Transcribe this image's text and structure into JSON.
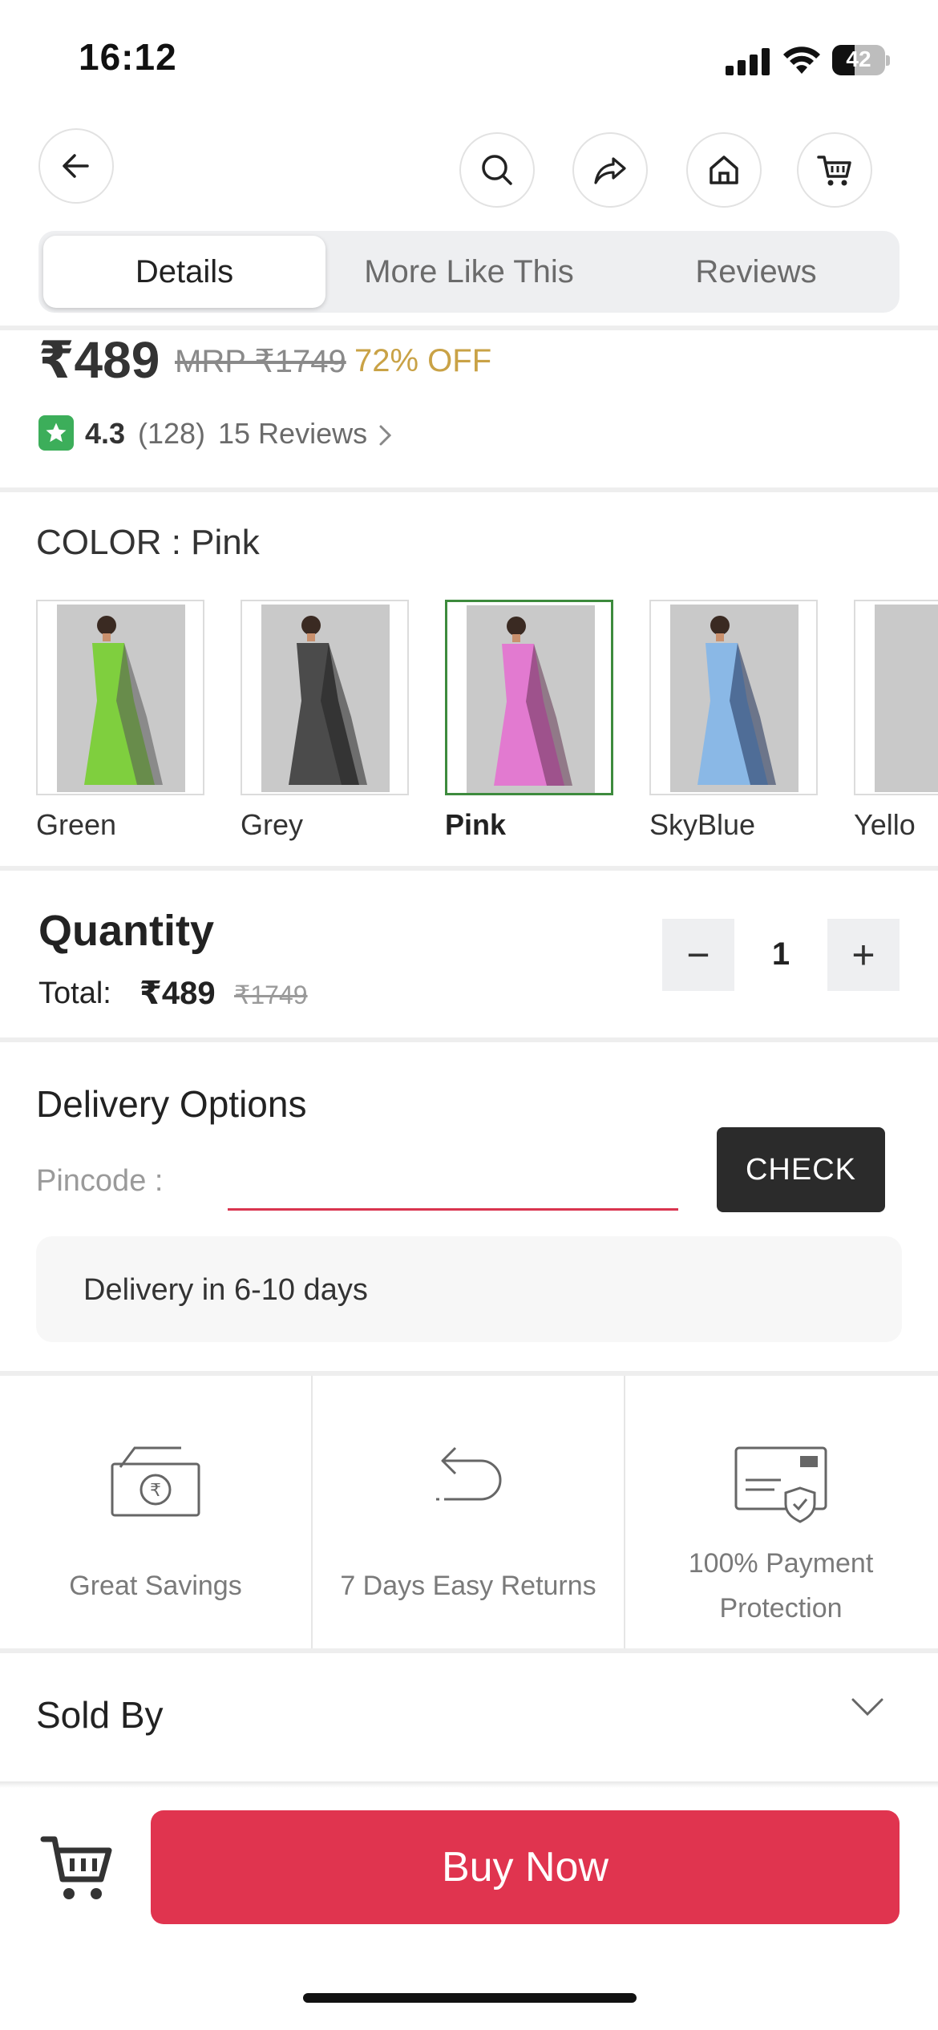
{
  "status_bar": {
    "time": "16:12",
    "battery": "42",
    "battery_level_pct": 42
  },
  "top_nav": {
    "back_icon": "arrow-left-icon",
    "actions": [
      "search-icon",
      "share-icon",
      "home-icon",
      "cart-icon"
    ]
  },
  "tabs": [
    {
      "label": "Details",
      "active": true
    },
    {
      "label": "More Like This",
      "active": false
    },
    {
      "label": "Reviews",
      "active": false
    }
  ],
  "price": {
    "current": "₹489",
    "mrp": "MRP ₹1749",
    "discount": "72% OFF"
  },
  "rating": {
    "value": "4.3",
    "count": "(128)",
    "reviews": "15 Reviews"
  },
  "color": {
    "label": "COLOR : Pink",
    "options": [
      {
        "name": "Green",
        "saree": "#7fcf3e",
        "selected": false
      },
      {
        "name": "Grey",
        "saree": "#4b4b4b",
        "selected": false
      },
      {
        "name": "Pink",
        "saree": "#e27ad0",
        "selected": true
      },
      {
        "name": "SkyBlue",
        "saree": "#8ab8e6",
        "selected": false
      },
      {
        "name": "Yello",
        "saree": "#e7d23c",
        "selected": false
      }
    ]
  },
  "quantity": {
    "title": "Quantity",
    "total_label": "Total:",
    "total_price": "₹489",
    "total_mrp": "₹1749",
    "decrement": "−",
    "value": "1",
    "increment": "+"
  },
  "delivery": {
    "title": "Delivery Options",
    "pincode_label": "Pincode :",
    "pincode_value": "",
    "check_label": "CHECK",
    "estimate": "Delivery in 6-10 days"
  },
  "features": [
    {
      "icon": "cash-icon",
      "label_lines": [
        "Great Savings"
      ]
    },
    {
      "icon": "return-arrow-icon",
      "label_lines": [
        "7 Days Easy Returns"
      ]
    },
    {
      "icon": "secure-card-icon",
      "label_lines": [
        "100% Payment",
        "Protection"
      ]
    }
  ],
  "sold_by": {
    "label": "Sold By"
  },
  "bottom_bar": {
    "cart_icon": "cart-icon",
    "buy_label": "Buy Now"
  },
  "colors": {
    "accent_red": "#e0344f",
    "discount_gold": "#c9a246",
    "rating_green": "#3cae5a",
    "selected_border": "#3d8b3d"
  }
}
